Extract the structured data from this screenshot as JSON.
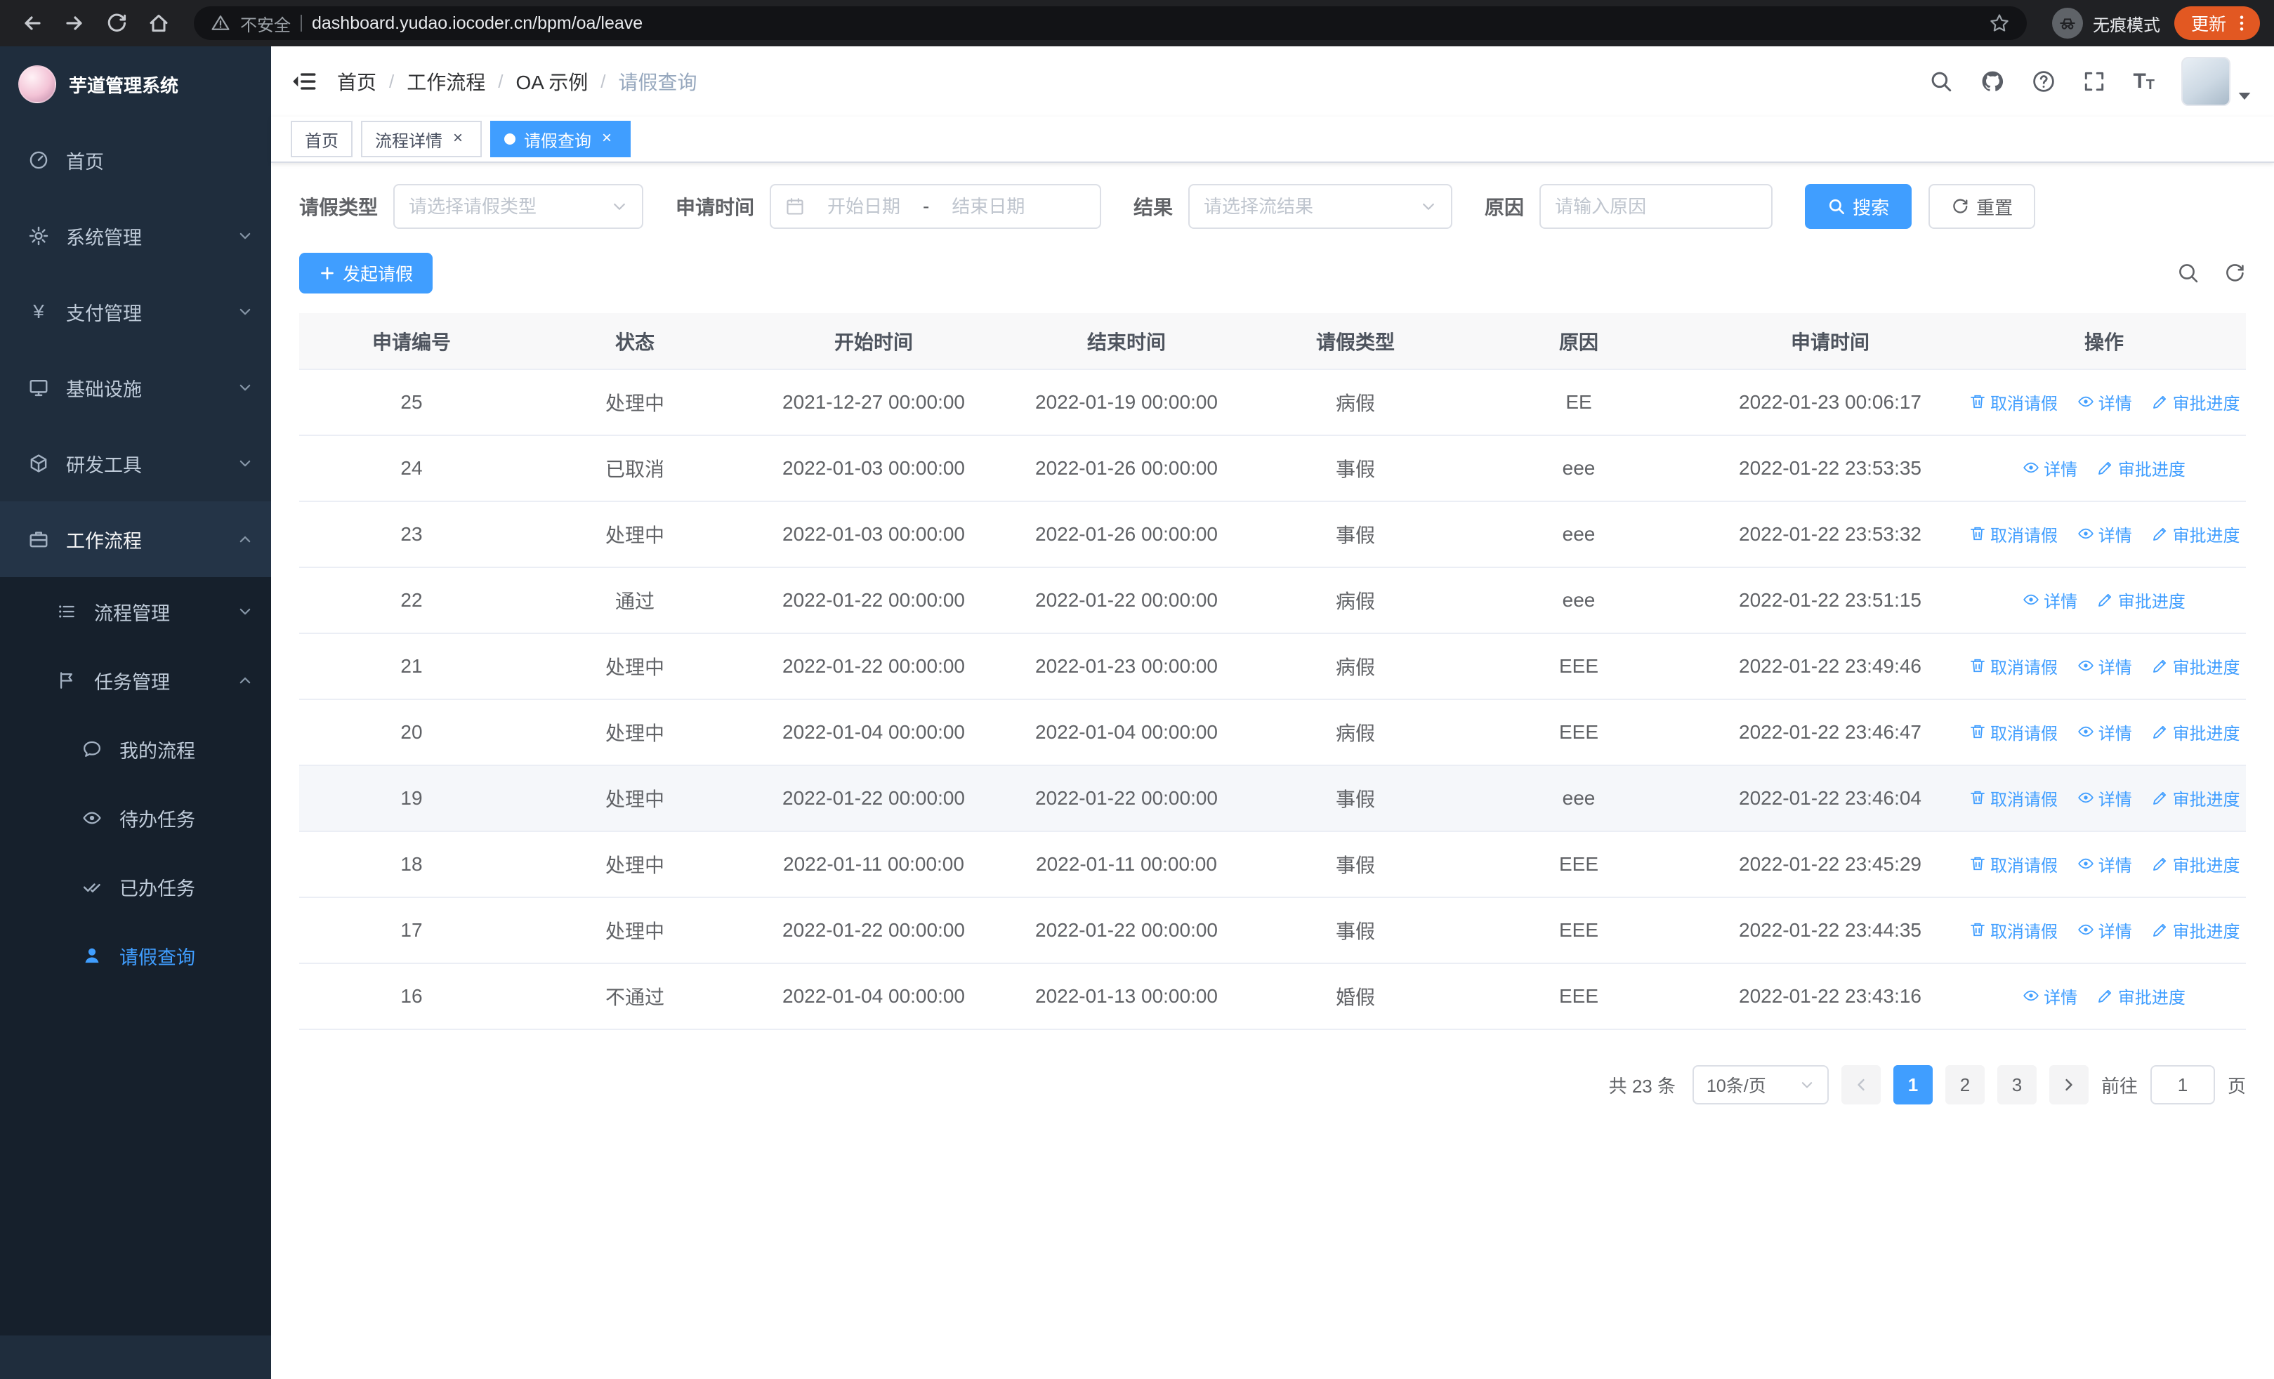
{
  "colors": {
    "primary": "#409eff",
    "sidebar_bg": "#1f2d3d",
    "submenu_bg": "#16202c",
    "update_chip": "#e25822",
    "active_tab": "#409eff"
  },
  "browser": {
    "security_warning": "不安全",
    "url": "dashboard.yudao.iocoder.cn/bpm/oa/leave",
    "incognito_label": "无痕模式",
    "update_label": "更新"
  },
  "sidebar": {
    "logo_title": "芋道管理系统",
    "items": [
      {
        "label": "首页"
      },
      {
        "label": "系统管理"
      },
      {
        "label": "支付管理"
      },
      {
        "label": "基础设施"
      },
      {
        "label": "研发工具"
      },
      {
        "label": "工作流程"
      },
      {
        "label": "流程管理"
      },
      {
        "label": "任务管理"
      },
      {
        "label": "我的流程"
      },
      {
        "label": "待办任务"
      },
      {
        "label": "已办任务"
      },
      {
        "label": "请假查询"
      }
    ]
  },
  "header": {
    "breadcrumb": [
      "首页",
      "工作流程",
      "OA 示例",
      "请假查询"
    ],
    "separator": "/"
  },
  "tabs": [
    {
      "label": "首页"
    },
    {
      "label": "流程详情"
    },
    {
      "label": "请假查询"
    }
  ],
  "filters": {
    "leave_type_label": "请假类型",
    "leave_type_placeholder": "请选择请假类型",
    "apply_time_label": "申请时间",
    "start_date_placeholder": "开始日期",
    "range_separator": "-",
    "end_date_placeholder": "结束日期",
    "result_label": "结果",
    "result_placeholder": "请选择流结果",
    "reason_label": "原因",
    "reason_placeholder": "请输入原因",
    "search_label": "搜索",
    "reset_label": "重置"
  },
  "toolbar": {
    "create_label": "发起请假"
  },
  "table": {
    "columns": [
      "申请编号",
      "状态",
      "开始时间",
      "结束时间",
      "请假类型",
      "原因",
      "申请时间",
      "操作"
    ],
    "actions": {
      "cancel": "取消请假",
      "detail": "详情",
      "progress": "审批进度"
    },
    "rows": [
      {
        "id": "25",
        "status": "处理中",
        "start": "2021-12-27 00:00:00",
        "end": "2022-01-19 00:00:00",
        "type": "病假",
        "reason": "EE",
        "applied": "2022-01-23 00:06:17",
        "cancellable": true
      },
      {
        "id": "24",
        "status": "已取消",
        "start": "2022-01-03 00:00:00",
        "end": "2022-01-26 00:00:00",
        "type": "事假",
        "reason": "eee",
        "applied": "2022-01-22 23:53:35",
        "cancellable": false
      },
      {
        "id": "23",
        "status": "处理中",
        "start": "2022-01-03 00:00:00",
        "end": "2022-01-26 00:00:00",
        "type": "事假",
        "reason": "eee",
        "applied": "2022-01-22 23:53:32",
        "cancellable": true
      },
      {
        "id": "22",
        "status": "通过",
        "start": "2022-01-22 00:00:00",
        "end": "2022-01-22 00:00:00",
        "type": "病假",
        "reason": "eee",
        "applied": "2022-01-22 23:51:15",
        "cancellable": false
      },
      {
        "id": "21",
        "status": "处理中",
        "start": "2022-01-22 00:00:00",
        "end": "2022-01-23 00:00:00",
        "type": "病假",
        "reason": "EEE",
        "applied": "2022-01-22 23:49:46",
        "cancellable": true
      },
      {
        "id": "20",
        "status": "处理中",
        "start": "2022-01-04 00:00:00",
        "end": "2022-01-04 00:00:00",
        "type": "病假",
        "reason": "EEE",
        "applied": "2022-01-22 23:46:47",
        "cancellable": true
      },
      {
        "id": "19",
        "status": "处理中",
        "start": "2022-01-22 00:00:00",
        "end": "2022-01-22 00:00:00",
        "type": "事假",
        "reason": "eee",
        "applied": "2022-01-22 23:46:04",
        "cancellable": true
      },
      {
        "id": "18",
        "status": "处理中",
        "start": "2022-01-11 00:00:00",
        "end": "2022-01-11 00:00:00",
        "type": "事假",
        "reason": "EEE",
        "applied": "2022-01-22 23:45:29",
        "cancellable": true
      },
      {
        "id": "17",
        "status": "处理中",
        "start": "2022-01-22 00:00:00",
        "end": "2022-01-22 00:00:00",
        "type": "事假",
        "reason": "EEE",
        "applied": "2022-01-22 23:44:35",
        "cancellable": true
      },
      {
        "id": "16",
        "status": "不通过",
        "start": "2022-01-04 00:00:00",
        "end": "2022-01-13 00:00:00",
        "type": "婚假",
        "reason": "EEE",
        "applied": "2022-01-22 23:43:16",
        "cancellable": false
      }
    ]
  },
  "pagination": {
    "total_text": "共 23 条",
    "page_size": "10条/页",
    "pages": [
      "1",
      "2",
      "3"
    ],
    "goto_label": "前往",
    "goto_value": "1",
    "goto_suffix": "页"
  }
}
